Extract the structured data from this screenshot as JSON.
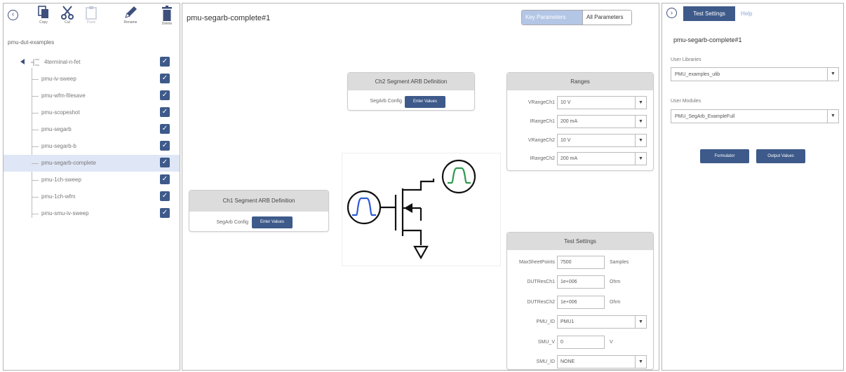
{
  "toolbar": {
    "copy": "Copy",
    "cut": "Cut",
    "paste": "Paste",
    "rename": "Rename",
    "delete": "Delete"
  },
  "project": {
    "root_label": "pmu-dut-examples",
    "device": "4terminal-n-fet",
    "tests": [
      "pmu-iv-sweep",
      "pmu-wfm-filesave",
      "pmu-scopeshot",
      "pmu-segarb",
      "pmu-segarb-b",
      "pmu-segarb-complete",
      "pmu-1ch-sweep",
      "pmu-1ch-wfm",
      "pmu-smu-iv-sweep"
    ],
    "selected_test": "pmu-segarb-complete"
  },
  "main": {
    "title": "pmu-segarb-complete#1",
    "toggle": {
      "key_parameters": "Key Parameters",
      "all_parameters": "All Parameters"
    }
  },
  "ch1": {
    "title": "Ch1 Segment ARB Definition",
    "field_label": "SegArb Config",
    "button": "Enter Values"
  },
  "ch2": {
    "title": "Ch2 Segment ARB Definition",
    "field_label": "SegArb Config",
    "button": "Enter Values"
  },
  "ranges": {
    "title": "Ranges",
    "fields": [
      {
        "label": "VRangeCh1",
        "value": "10 V"
      },
      {
        "label": "IRangeCh1",
        "value": "200 mA"
      },
      {
        "label": "VRangeCh2",
        "value": "10 V"
      },
      {
        "label": "IRangeCh2",
        "value": "200 mA"
      }
    ]
  },
  "test_settings": {
    "title": "Test Settings",
    "max_sheet_points": {
      "label": "MaxSheetPoints",
      "value": "7500",
      "unit": "Samples"
    },
    "dut_res_ch1": {
      "label": "DUTResCh1",
      "value": "1e+006",
      "unit": "Ohm"
    },
    "dut_res_ch2": {
      "label": "DUTResCh2",
      "value": "1e+006",
      "unit": "Ohm"
    },
    "pmu_id": {
      "label": "PMU_ID",
      "value": "PMU1"
    },
    "smu_v": {
      "label": "SMU_V",
      "value": "0",
      "unit": "V"
    },
    "smu_id": {
      "label": "SMU_ID",
      "value": "NONE"
    }
  },
  "right": {
    "tab_test_settings": "Test Settings",
    "tab_help": "Help",
    "title": "pmu-segarb-complete#1",
    "user_libraries_label": "User Libraries",
    "user_libraries_value": "PMU_examples_ulib",
    "user_modules_label": "User Modules",
    "user_modules_value": "PMU_SegArb_ExampleFull",
    "formulator": "Formulator",
    "output_values": "Output Values"
  },
  "colors": {
    "accent": "#3d5a8a",
    "accent_light": "#b3c6e6",
    "selected_row": "#dfe6f5",
    "gate_waveform": "#2f5bd6",
    "drain_waveform": "#2e9a4e"
  },
  "icons": {
    "collapse": "chevron-left-icon",
    "expand": "chevron-right-icon",
    "copy": "copy-icon",
    "cut": "scissors-icon",
    "paste": "paste-icon",
    "rename": "pencil-icon",
    "delete": "trash-icon",
    "device": "fet-icon",
    "checkbox": "checkmark-icon"
  }
}
